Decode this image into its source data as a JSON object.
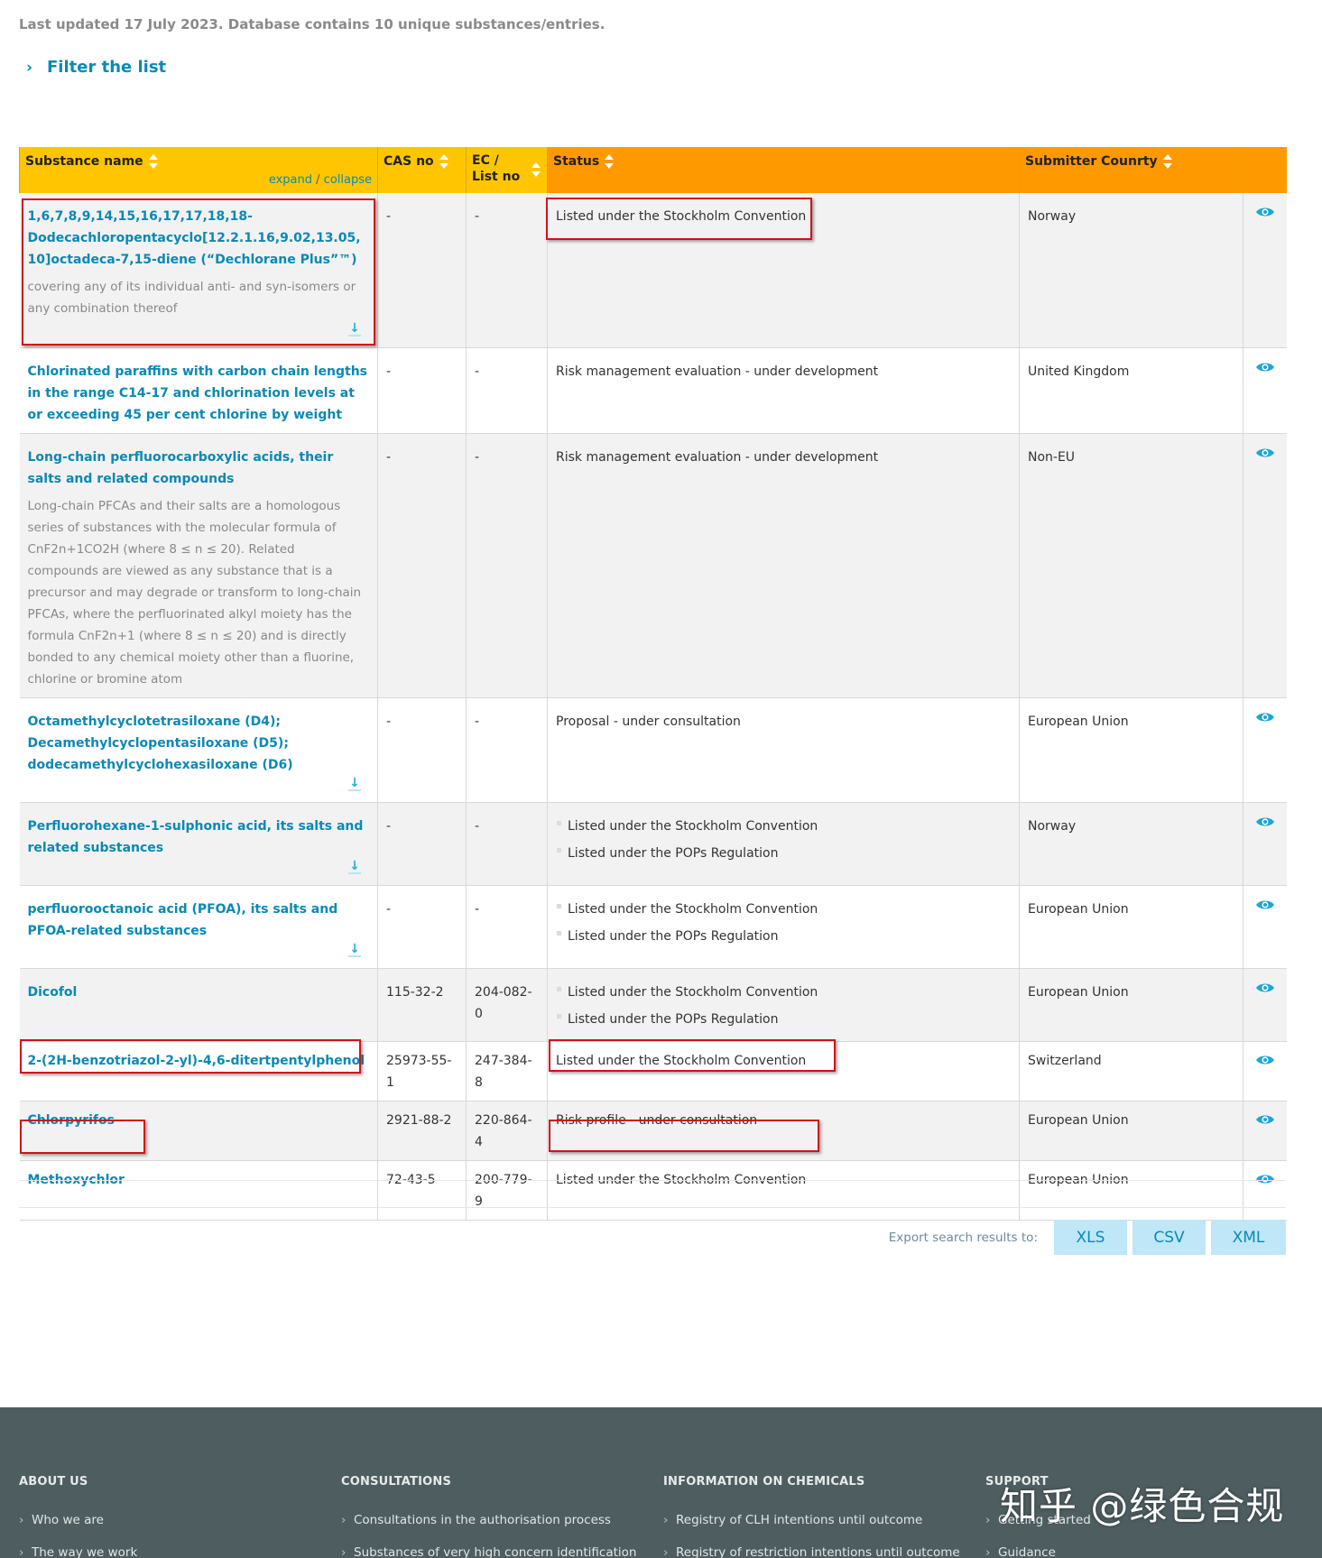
{
  "page": {
    "updated_text": "Last updated 17 July 2023. Database contains 10 unique substances/entries.",
    "filter_label": "Filter the list"
  },
  "table": {
    "headers": {
      "name": "Substance name",
      "expand": "expand",
      "sep": " / ",
      "collapse": "collapse",
      "cas": "CAS no",
      "ec_line1": "EC /",
      "ec_line2": "List no",
      "status": "Status",
      "country": "Submitter Counrty"
    },
    "rows": [
      {
        "name": "1,6,7,8,9,14,15,16,17,17,18,18-Dodecachloropentacyclo[12.2.1.16,9.02,13.05,10]octadeca-7,15-diene (“Dechlorane Plus”™)",
        "desc": "covering any of its individual anti- and syn-isomers or any combination thereof",
        "cas": "-",
        "ec": "-",
        "status": [
          "Listed under the Stockholm Convention"
        ],
        "country": "Norway"
      },
      {
        "name": "Chlorinated paraffins with carbon chain lengths in the range C14-17 and chlorination levels at or exceeding 45 per cent chlorine by weight",
        "cas": "-",
        "ec": "-",
        "status": [
          "Risk management evaluation - under development"
        ],
        "country": "United Kingdom"
      },
      {
        "name": "Long-chain perfluorocarboxylic acids, their salts and related compounds",
        "desc": "Long-chain PFCAs and their salts are a homologous series of substances with the molecular formula of CnF2n+1CO2H (where 8 ≤ n ≤ 20). Related compounds are viewed as any substance that is a precursor and may degrade or transform to long-chain PFCAs, where the perfluorinated alkyl moiety has the formula CnF2n+1 (where 8 ≤ n ≤ 20) and is directly bonded to any chemical moiety other than a fluorine, chlorine or bromine atom",
        "cas": "-",
        "ec": "-",
        "status": [
          "Risk management evaluation - under development"
        ],
        "country": "Non-EU"
      },
      {
        "name": "Octamethylcyclotetrasiloxane (D4); Decamethylcyclopentasiloxane (D5); dodecamethylcyclohexasiloxane (D6)",
        "cas": "-",
        "ec": "-",
        "status": [
          "Proposal - under consultation"
        ],
        "country": "European Union"
      },
      {
        "name": "Perfluorohexane-1-sulphonic acid, its salts and related substances",
        "cas": "-",
        "ec": "-",
        "status": [
          "Listed under the Stockholm Convention",
          "Listed under the POPs Regulation"
        ],
        "country": "Norway"
      },
      {
        "name": "perfluorooctanoic acid (PFOA), its salts and PFOA-related substances",
        "cas": "-",
        "ec": "-",
        "status": [
          "Listed under the Stockholm Convention",
          "Listed under the POPs Regulation"
        ],
        "country": "European Union"
      },
      {
        "name": "Dicofol",
        "cas": "115-32-2",
        "ec": "204-082-0",
        "status": [
          "Listed under the Stockholm Convention",
          "Listed under the POPs Regulation"
        ],
        "country": "European Union"
      },
      {
        "name": "2-(2H-benzotriazol-2-yl)-4,6-ditertpentylphenol",
        "cas": "25973-55-1",
        "ec": "247-384-8",
        "status": [
          "Listed under the Stockholm Convention"
        ],
        "country": "Switzerland"
      },
      {
        "name": "Chlorpyrifos",
        "cas": "2921-88-2",
        "ec": "220-864-4",
        "status": [
          "Risk profile - under consultation"
        ],
        "country": "European Union"
      },
      {
        "name": "Methoxychlor",
        "cas": "72-43-5",
        "ec": "200-779-9",
        "status": [
          "Listed under the Stockholm Convention"
        ],
        "country": "European Union"
      }
    ]
  },
  "export": {
    "label": "Export search results to:",
    "xls": "XLS",
    "csv": "CSV",
    "xml": "XML"
  },
  "footer": {
    "about": {
      "title": "ABOUT US",
      "links": [
        "Who we are",
        "The way we work"
      ]
    },
    "consultations": {
      "title": "CONSULTATIONS",
      "links": [
        "Consultations in the authorisation process",
        "Substances of very high concern identification"
      ]
    },
    "info": {
      "title": "INFORMATION ON CHEMICALS",
      "links": [
        "Registry of CLH intentions until outcome",
        "Registry of restriction intentions until outcome"
      ]
    },
    "support": {
      "title": "SUPPORT",
      "links": [
        "Getting started",
        "Guidance"
      ]
    }
  },
  "watermark": "知乎 @绿色合规",
  "colors": {
    "accent": "#0a89b5",
    "header_yellow": "#ffc600",
    "header_orange": "#ff9900",
    "highlight_red": "#d0121b",
    "footer_bg": "#4e5d60"
  },
  "icons": {
    "filter": "chevron-right-icon",
    "sort": "sort-icon",
    "view": "eye-icon",
    "expand_row": "arrow-down-icon"
  }
}
